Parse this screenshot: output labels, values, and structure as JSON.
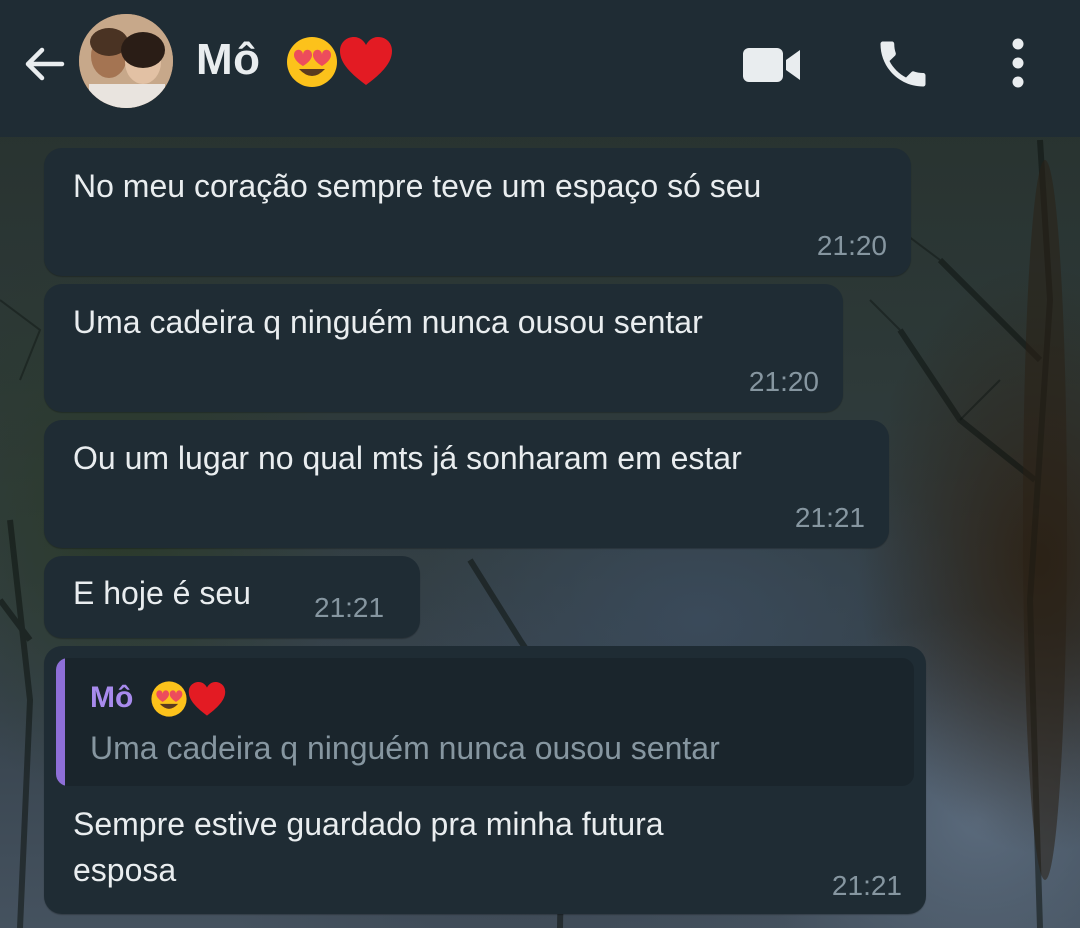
{
  "header": {
    "contact_name": "Mô",
    "accent": "#1f2c34",
    "icons": [
      "back-arrow-icon",
      "video-camera-icon",
      "phone-icon",
      "more-vert-icon"
    ]
  },
  "messages": [
    {
      "text": "No meu coração sempre teve um espaço só seu",
      "time": "21:20"
    },
    {
      "text": "Uma cadeira q ninguém nunca ousou sentar",
      "time": "21:20"
    },
    {
      "text": "Ou um lugar no qual mts já sonharam em estar",
      "time": "21:21"
    },
    {
      "text": "E hoje é seu",
      "time": "21:21"
    },
    {
      "quote": {
        "author": "Mô",
        "text": "Uma cadeira q ninguém nunca ousou sentar"
      },
      "text_line1": "Sempre estive guardado pra minha futura",
      "text_line2": "esposa",
      "time": "21:21"
    }
  ],
  "colors": {
    "bubble": "#1f2c34",
    "text": "#e9edef",
    "time": "#8696a0",
    "quote_accent": "#8e6fd8"
  }
}
